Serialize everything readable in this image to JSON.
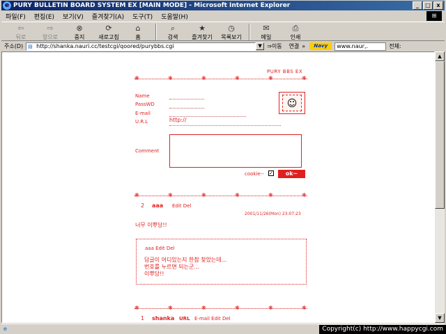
{
  "window": {
    "title": "PURY BULLETIN BOARD SYSTEM EX [MAIN MODE] - Microsoft Internet Explorer",
    "min_label": "_",
    "max_label": "□",
    "close_label": "x"
  },
  "menu": [
    "파일(F)",
    "편집(E)",
    "보기(V)",
    "즐겨찾기(A)",
    "도구(T)",
    "도움말(H)"
  ],
  "toolbar": {
    "back": "뒤로",
    "forward": "앞으로",
    "stop": "중지",
    "refresh": "새로고침",
    "home": "홈",
    "search": "검색",
    "favorites": "즐겨찾기",
    "history": "목록보기",
    "mail": "메일",
    "print": "인쇄"
  },
  "address": {
    "label": "주소(D)",
    "url": "http://shanka.nauri.cc/testcgi/qoored/purybbs.cgi",
    "go": "이동",
    "links": "연결",
    "navy": "Navy",
    "search_value": "www.naur,.",
    "all": "전체:"
  },
  "board": {
    "title": "PURY BBS EX",
    "form": {
      "name": "Name",
      "passwd": "PassWD",
      "email": "E-mail",
      "url": "U.R.L",
      "url_value": "http://",
      "comment": "Comment",
      "cookie": "cookie--",
      "cookie_check": "✓",
      "submit": "ok~"
    },
    "posts": [
      {
        "num": "2",
        "author": "aaa",
        "actions": "Edit Del",
        "date": "2001/11/26(Mon) 23:07:23",
        "body": "너무 이뿌당!!",
        "reply": {
          "head": "aaa Edit Del",
          "lines": [
            "답글이 어디있는지 한참 찾았는데...",
            "번호를 누르면 되는군...",
            "이뿌당!!"
          ]
        }
      },
      {
        "num": "1",
        "author": "shanka",
        "url": "URL",
        "actions": "E-mail Edit Del"
      }
    ]
  },
  "copyright": "Copyright(c) http://www.happycgi.com"
}
